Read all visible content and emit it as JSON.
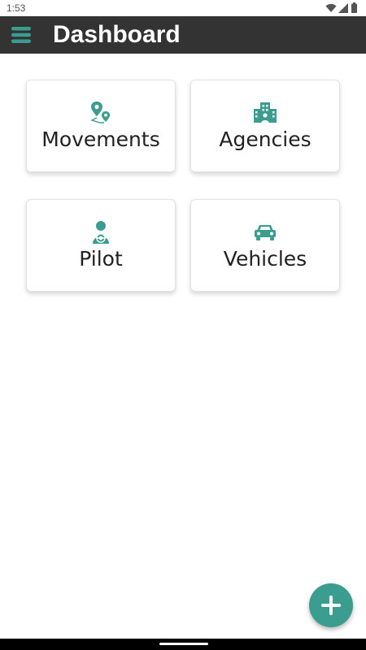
{
  "status_bar": {
    "time": "1:53"
  },
  "app_bar": {
    "title": "Dashboard"
  },
  "cards": [
    {
      "label": "Movements",
      "icon": "map-route-icon"
    },
    {
      "label": "Agencies",
      "icon": "buildings-icon"
    },
    {
      "label": "Pilot",
      "icon": "driver-icon"
    },
    {
      "label": "Vehicles",
      "icon": "car-icon"
    }
  ],
  "fab": {
    "icon": "plus-icon"
  },
  "colors": {
    "accent": "#3b9c90",
    "app_bar": "#333333",
    "card_text": "#222222"
  }
}
